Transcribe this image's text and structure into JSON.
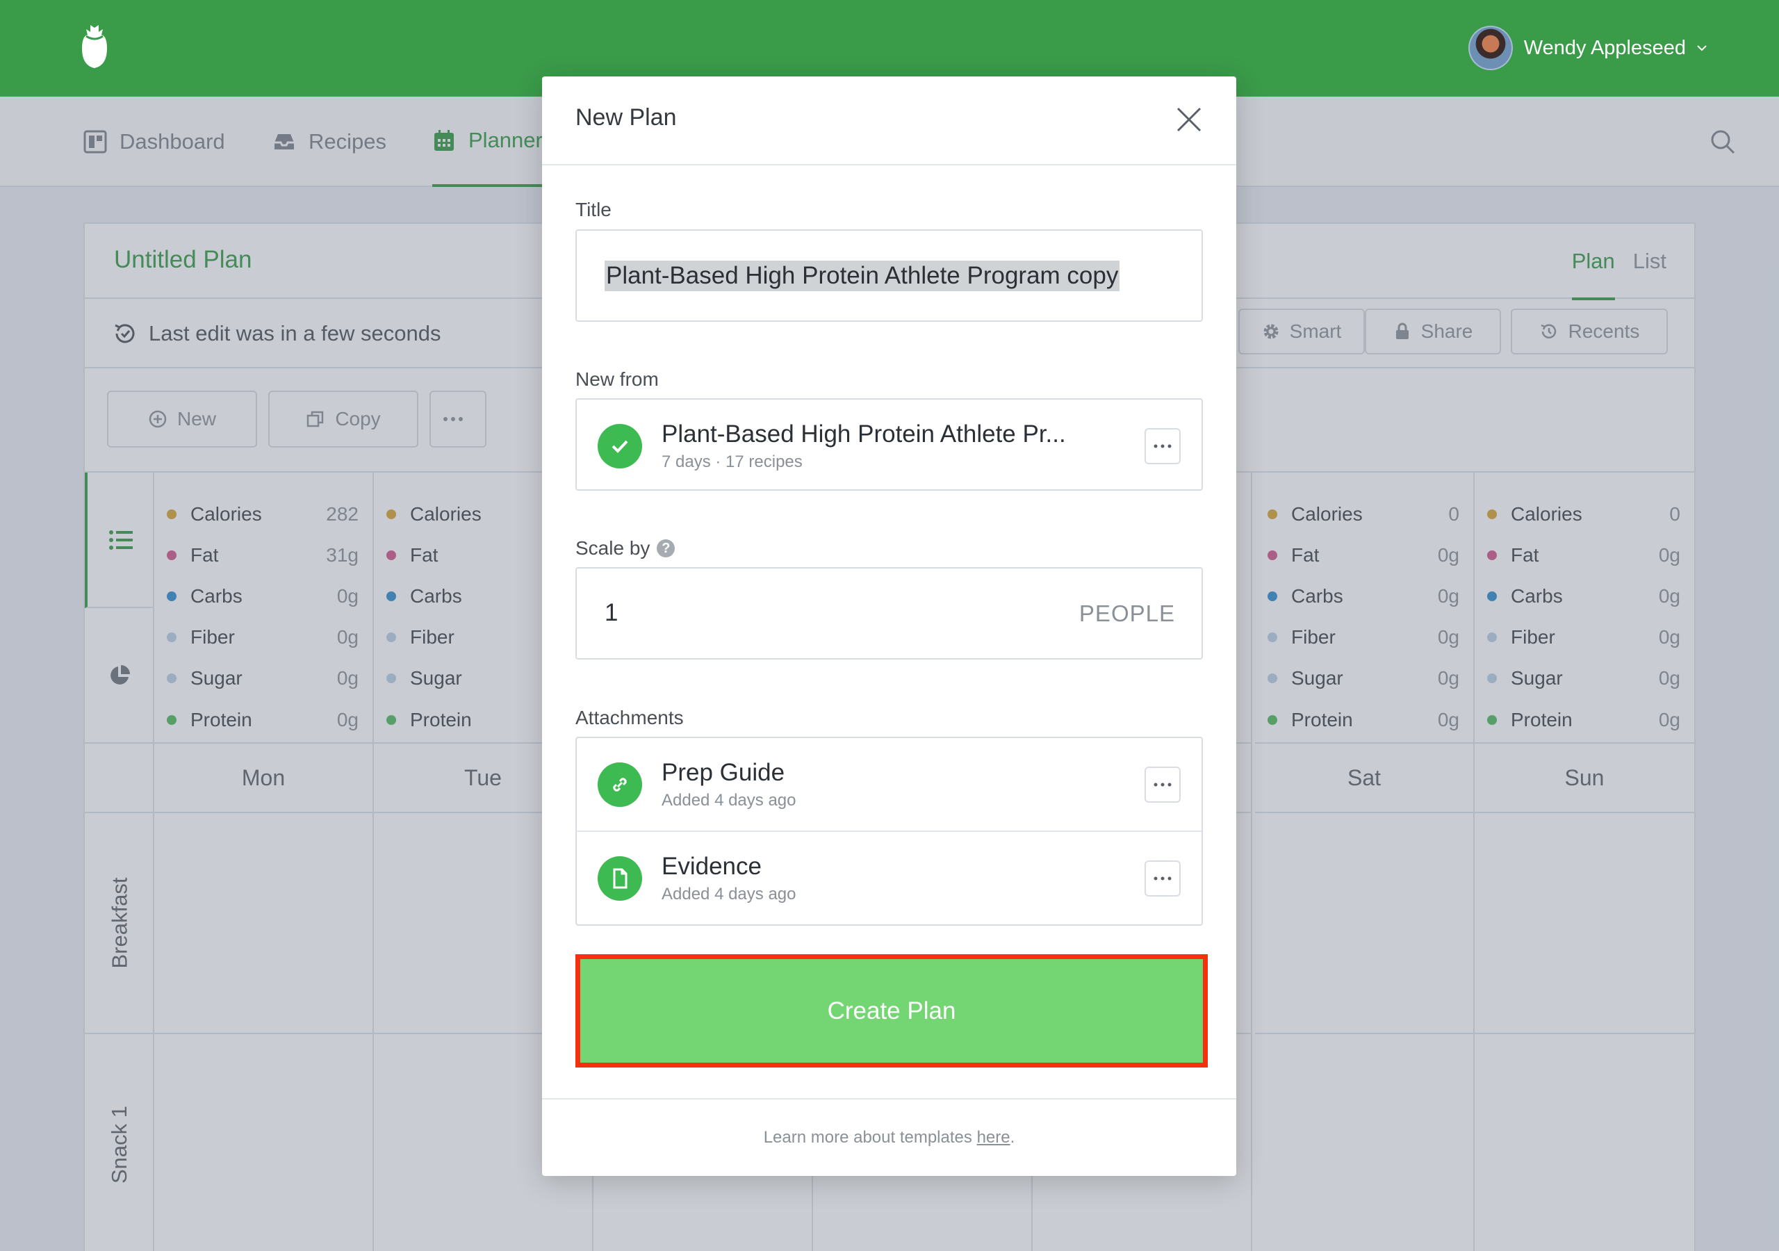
{
  "topbar": {
    "user_name": "Wendy Appleseed"
  },
  "nav": {
    "items": [
      {
        "label": "Dashboard"
      },
      {
        "label": "Recipes"
      },
      {
        "label": "Planner"
      }
    ]
  },
  "plan": {
    "title": "Untitled Plan",
    "view_tabs": [
      {
        "label": "Plan"
      },
      {
        "label": "List"
      }
    ],
    "last_edit": "Last edit was in a few seconds",
    "actions": [
      {
        "label": "Smart"
      },
      {
        "label": "Share"
      },
      {
        "label": "Recents"
      }
    ],
    "toolbar": {
      "new_label": "New",
      "copy_label": "Copy"
    },
    "nutrients": [
      "Calories",
      "Fat",
      "Carbs",
      "Fiber",
      "Sugar",
      "Protein"
    ],
    "days": [
      {
        "name": "Mon",
        "values": [
          "282",
          "31g",
          "0g",
          "0g",
          "0g",
          "0g"
        ]
      },
      {
        "name": "Tue",
        "values": [
          "",
          "",
          "",
          "",
          "",
          ""
        ]
      },
      {
        "name": "Sat",
        "values": [
          "0",
          "0g",
          "0g",
          "0g",
          "0g",
          "0g"
        ]
      },
      {
        "name": "Sun",
        "values": [
          "0",
          "0g",
          "0g",
          "0g",
          "0g",
          "0g"
        ]
      }
    ],
    "meal_slots": [
      "Breakfast",
      "Snack 1"
    ]
  },
  "modal": {
    "title": "New Plan",
    "title_label": "Title",
    "title_value": "Plant-Based High Protein Athlete Program copy",
    "new_from_label": "New from",
    "source": {
      "title": "Plant-Based High Protein Athlete Pr...",
      "meta": "7 days · 17 recipes"
    },
    "scale_label": "Scale by",
    "scale_value": "1",
    "scale_unit": "PEOPLE",
    "attachments_label": "Attachments",
    "attachments": [
      {
        "title": "Prep Guide",
        "meta": "Added 4 days ago"
      },
      {
        "title": "Evidence",
        "meta": "Added 4 days ago"
      }
    ],
    "create_label": "Create Plan",
    "footer_text": "Learn more about templates ",
    "footer_link": "here",
    "footer_end": "."
  },
  "colors": {
    "brand_green": "#3a9b49",
    "create_button": "#74d672",
    "highlight_border": "#f6300e",
    "calories": "#d8a12f",
    "fat": "#d0558a",
    "carbs": "#2d8ad0",
    "fiber": "#b9cfe6",
    "sugar": "#b9cfe6",
    "protein": "#4db85b"
  }
}
